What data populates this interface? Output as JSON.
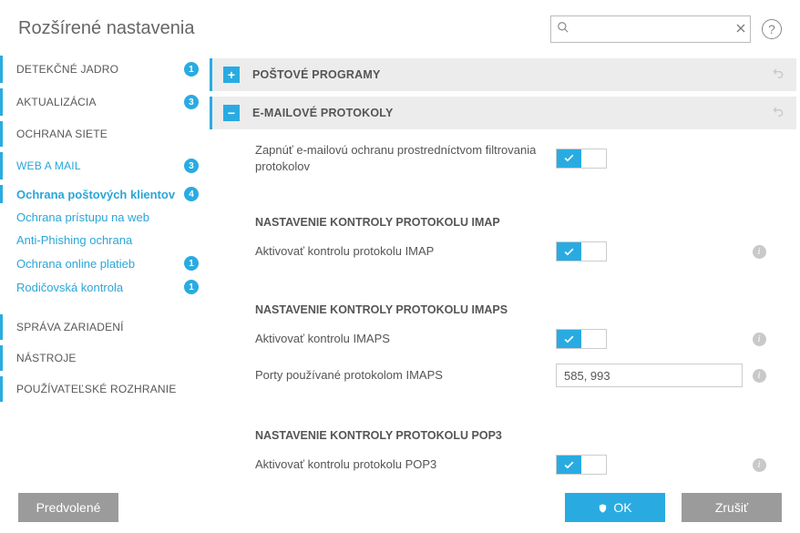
{
  "header": {
    "title": "Rozšírené nastavenia",
    "search_placeholder": ""
  },
  "sidebar": {
    "items": [
      {
        "label": "DETEKČNÉ JADRO",
        "badge": "1",
        "type": "top",
        "bar": true
      },
      {
        "label": "AKTUALIZÁCIA",
        "badge": "3",
        "type": "top",
        "bar": true
      },
      {
        "label": "OCHRANA SIETE",
        "type": "top",
        "bar": true
      },
      {
        "label": "WEB A MAIL",
        "badge": "3",
        "type": "top",
        "bar": true,
        "activeTop": true
      },
      {
        "label": "Ochrana poštových klientov",
        "badge": "4",
        "type": "sub",
        "activeSub": true
      },
      {
        "label": "Ochrana prístupu na web",
        "type": "sub"
      },
      {
        "label": "Anti-Phishing ochrana",
        "type": "sub"
      },
      {
        "label": "Ochrana online platieb",
        "badge": "1",
        "type": "sub"
      },
      {
        "label": "Rodičovská kontrola",
        "badge": "1",
        "type": "sub"
      },
      {
        "label": "SPRÁVA ZARIADENÍ",
        "type": "top",
        "bar": true,
        "gapTop": true
      },
      {
        "label": "NÁSTROJE",
        "type": "top",
        "bar": true
      },
      {
        "label": "POUŽÍVATEĽSKÉ ROZHRANIE",
        "type": "top",
        "bar": true
      }
    ]
  },
  "sections": {
    "mail_programs": {
      "title": "POŠTOVÉ PROGRAMY",
      "expanded": false
    },
    "email_protocols": {
      "title": "E-MAILOVÉ PROTOKOLY",
      "expanded": true,
      "enable_label": "Zapnúť e-mailovú ochranu prostredníctvom filtrovania protokolov",
      "imap_heading": "NASTAVENIE KONTROLY PROTOKOLU IMAP",
      "imap_enable": "Aktivovať kontrolu protokolu IMAP",
      "imaps_heading": "NASTAVENIE KONTROLY PROTOKOLU IMAPS",
      "imaps_enable": "Aktivovať kontrolu IMAPS",
      "imaps_ports_label": "Porty používané protokolom IMAPS",
      "imaps_ports_value": "585, 993",
      "pop3_heading": "NASTAVENIE KONTROLY PROTOKOLU POP3",
      "pop3_enable": "Aktivovať kontrolu protokolu POP3"
    }
  },
  "footer": {
    "defaults": "Predvolené",
    "ok": "OK",
    "cancel": "Zrušiť"
  }
}
